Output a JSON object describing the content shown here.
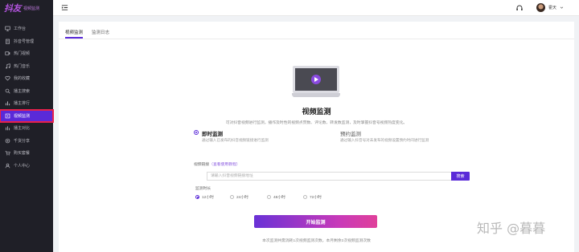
{
  "brand": {
    "logo_text": "抖友",
    "subtitle": "视频监测"
  },
  "sidebar": {
    "items": [
      {
        "label": "工作台",
        "icon": "monitor-icon",
        "active": false
      },
      {
        "label": "抖音号管理",
        "icon": "clipboard-icon",
        "active": false
      },
      {
        "label": "热门视频",
        "icon": "video-icon",
        "active": false
      },
      {
        "label": "热门音乐",
        "icon": "music-icon",
        "active": false
      },
      {
        "label": "我的收藏",
        "icon": "heart-icon",
        "active": false
      },
      {
        "label": "播主搜索",
        "icon": "search-icon",
        "active": false
      },
      {
        "label": "播主排行",
        "icon": "bar-chart-icon",
        "active": false
      },
      {
        "label": "视频监测",
        "icon": "video-monitor-icon",
        "active": true
      },
      {
        "label": "播主对比",
        "icon": "compare-icon",
        "active": false
      },
      {
        "label": "千货分享",
        "icon": "share-icon",
        "active": false
      },
      {
        "label": "购买套餐",
        "icon": "cart-icon",
        "active": false
      },
      {
        "label": "个人中心",
        "icon": "user-icon",
        "active": false
      }
    ]
  },
  "header": {
    "username": "霍天"
  },
  "tabs": [
    {
      "label": "视频监测",
      "active": true
    },
    {
      "label": "监测日志",
      "active": false
    }
  ],
  "main": {
    "title": "视频监测",
    "description": "可对抖音视频进行监测，播作及时性的视频点赞数、评论数、转发数监测，及时掌握抖音号视频热度变化。",
    "modes": [
      {
        "title": "即时监测",
        "desc": "通过输入已发布的抖音视频链接进行监测",
        "checked": true
      },
      {
        "title": "预约监测",
        "desc": "通过输入抖音号对未发布的视频设置预约时间进行监测",
        "checked": false
      }
    ],
    "link_label": "视频链接",
    "link_tip": "（查看使用教程）",
    "url_placeholder": "请输入抖音视频链接地址",
    "search_label": "搜索",
    "duration_label": "监测时长",
    "durations": [
      {
        "label": "12小时",
        "checked": true
      },
      {
        "label": "24小时",
        "checked": false
      },
      {
        "label": "48小时",
        "checked": false
      },
      {
        "label": "72小时",
        "checked": false
      }
    ],
    "start_label": "开始监测",
    "quota_text": "本次监测共需消耗1次视频监测次数，本月剩余2次视频监测次数"
  },
  "watermark": "知乎 @暮暮",
  "colors": {
    "accent": "#5a2ad8",
    "sidebar_bg": "#1f1f27",
    "active_outline": "#e8204c"
  }
}
